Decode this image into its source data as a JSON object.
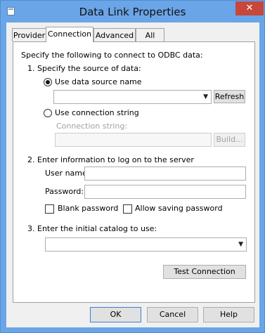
{
  "window": {
    "title": "Data Link Properties",
    "close_glyph": "✕"
  },
  "tabs": [
    {
      "label": "Provider",
      "active": false
    },
    {
      "label": "Connection",
      "active": true
    },
    {
      "label": "Advanced",
      "active": false
    },
    {
      "label": "All",
      "active": false
    }
  ],
  "connection": {
    "intro": "Specify the following to connect to ODBC data:",
    "step1": "1. Specify the source of data:",
    "use_dsn_label": "Use data source name",
    "use_dsn_selected": true,
    "dsn_value": "",
    "refresh_label": "Refresh",
    "use_connstr_label": "Use connection string",
    "use_connstr_selected": false,
    "connstr_caption": "Connection string:",
    "connstr_value": "",
    "build_label": "Build...",
    "step2": "2. Enter information to log on to the server",
    "username_label": "User name:",
    "username_value": "",
    "password_label": "Password:",
    "password_value": "",
    "blank_password_label": "Blank password",
    "blank_password_checked": false,
    "allow_saving_label": "Allow saving password",
    "allow_saving_checked": false,
    "step3": "3. Enter the initial catalog to use:",
    "catalog_value": "",
    "test_label": "Test Connection"
  },
  "footer": {
    "ok": "OK",
    "cancel": "Cancel",
    "help": "Help"
  },
  "colors": {
    "titlebar": "#6aa5e8",
    "close": "#c7473a",
    "face": "#f0f0f0"
  },
  "icons": {
    "dropdown": "▼"
  }
}
